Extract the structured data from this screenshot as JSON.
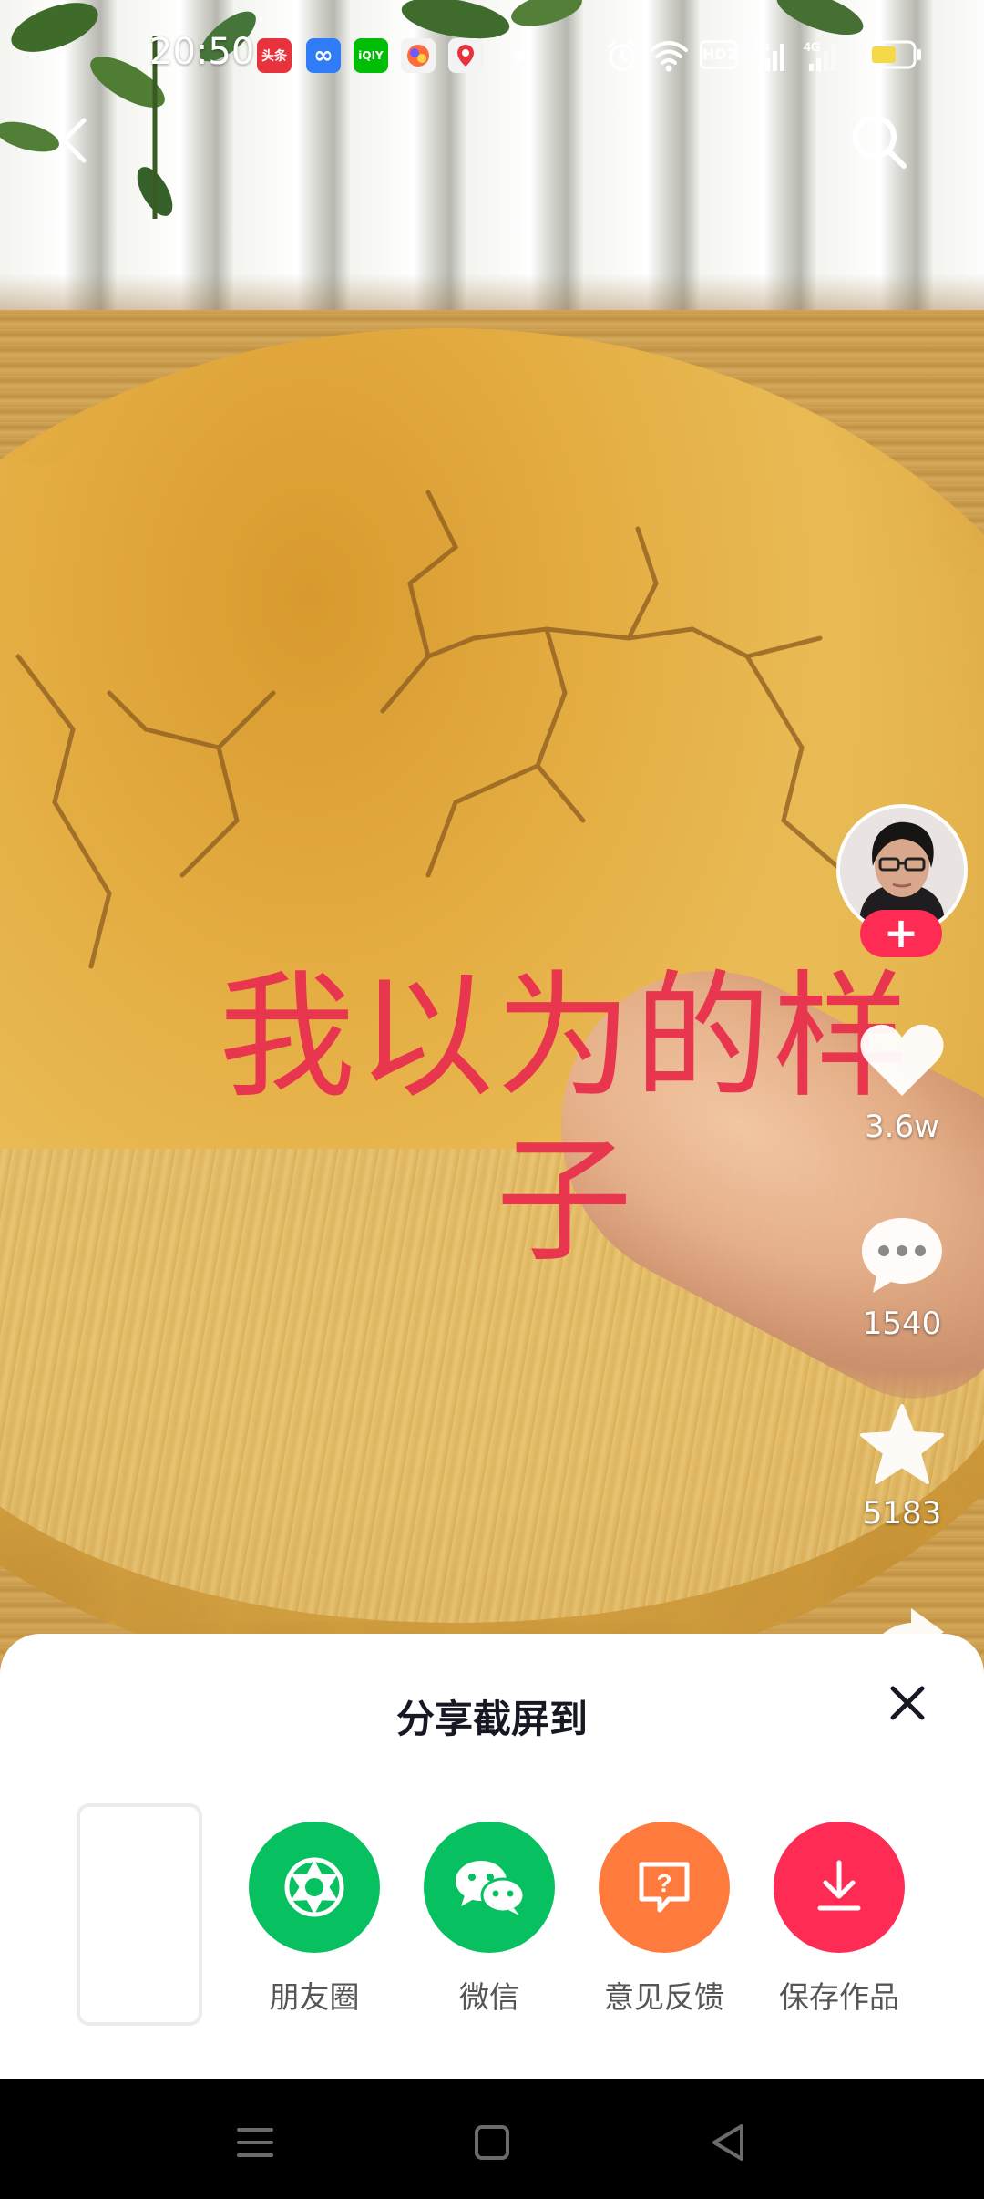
{
  "status_bar": {
    "time": "20:50",
    "notifications": [
      {
        "name": "toutiao",
        "label": "头条",
        "color": "#e8333c"
      },
      {
        "name": "infinity",
        "label": "∞",
        "color": "#2f7cf6"
      },
      {
        "name": "iqiyi",
        "label": "iQIY",
        "color": "#00be06"
      },
      {
        "name": "app-colorful",
        "label": "",
        "color": "#f0f0f0"
      },
      {
        "name": "map-pin",
        "label": "",
        "color": "#f0f0f0"
      }
    ],
    "network_labels": [
      "HD2",
      "4G",
      "4G"
    ]
  },
  "video": {
    "caption": "我以为的样子"
  },
  "sidebar": {
    "follow_symbol": "+",
    "like_count": "3.6w",
    "comment_count": "1540",
    "favorite_count": "5183"
  },
  "share_sheet": {
    "title": "分享截屏到",
    "options": [
      {
        "label": "朋友圈",
        "color": "#07c160",
        "icon": "moments-icon"
      },
      {
        "label": "微信",
        "color": "#07c160",
        "icon": "wechat-icon"
      },
      {
        "label": "意见反馈",
        "color": "#fe7b3d",
        "icon": "feedback-icon"
      },
      {
        "label": "保存作品",
        "color": "#fe2c55",
        "icon": "download-icon"
      }
    ]
  }
}
